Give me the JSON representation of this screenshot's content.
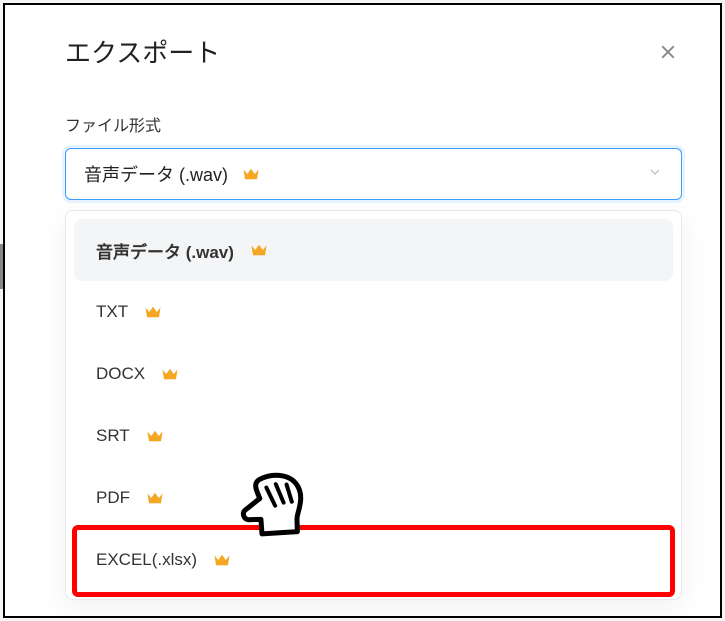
{
  "modal": {
    "title": "エクスポート",
    "field_label": "ファイル形式",
    "selected_value": "音声データ (.wav)"
  },
  "dropdown": {
    "options": [
      {
        "label": "音声データ (.wav)",
        "selected": true
      },
      {
        "label": "TXT"
      },
      {
        "label": "DOCX"
      },
      {
        "label": "SRT"
      },
      {
        "label": "PDF"
      },
      {
        "label": "EXCEL(.xlsx)"
      }
    ]
  },
  "annotation": {
    "highlighted_index": 5
  }
}
